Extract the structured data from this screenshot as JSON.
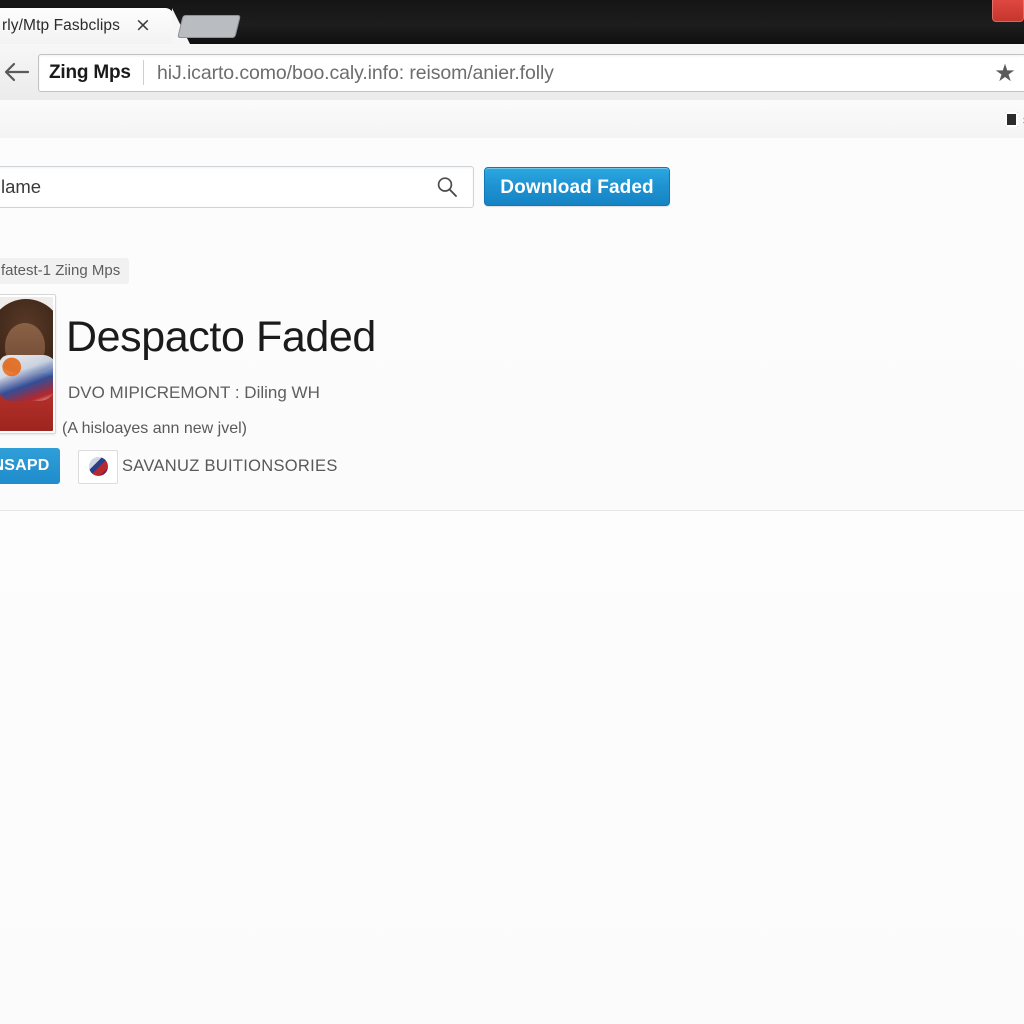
{
  "browser": {
    "tab": {
      "title": "rly/Mtp Fasbclips",
      "close_glyph": "×"
    },
    "newtab_name": "new-tab-button",
    "window_close_name": "window-close-button",
    "toolbar": {
      "back_label": "back",
      "site_chip": "Zing Mps",
      "url": "hiJ.icarto.como/boo.caly.info: reisom/anier.folly",
      "star_glyph": "★"
    },
    "bookmarks": [
      {
        "label": "s"
      }
    ]
  },
  "page": {
    "search": {
      "value": "lame",
      "placeholder": "lame",
      "icon": "search-icon"
    },
    "download_button": "Download Faded",
    "breadcrumb": "fatest-1 Ziing Mps",
    "title": "Despacto Faded",
    "meta_line_1": "DVO MIPICREMONT : Diling WH",
    "meta_line_2": "(A hisloayes ann new jvel)",
    "secondary_button": "NSAPD",
    "source_label": "SAVANUZ BUITIONSORIES",
    "thumbnail_name": "track-thumbnail"
  },
  "colors": {
    "accent_blue": "#1f93d2",
    "tabstrip_dark": "#1a1a1a",
    "close_red": "#d23a31",
    "text_primary": "#1b1b1b",
    "text_muted": "#5e5e5e"
  }
}
